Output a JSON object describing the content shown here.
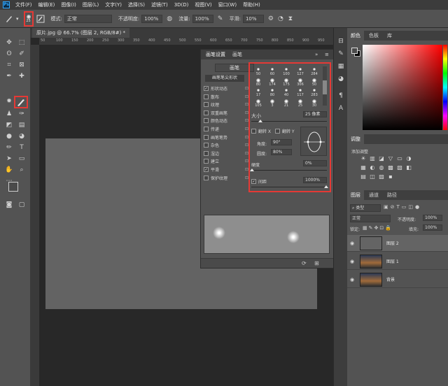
{
  "app": {
    "logo": "Ps"
  },
  "menubar": {
    "items": [
      "文件(F)",
      "编辑(E)",
      "图像(I)",
      "图层(L)",
      "文字(Y)",
      "选择(S)",
      "滤镜(T)",
      "3D(D)",
      "视图(V)",
      "窗口(W)",
      "帮助(H)"
    ]
  },
  "options": {
    "brush_size": "25",
    "mode_label": "模式:",
    "mode_value": "正常",
    "opacity_label": "不透明度:",
    "opacity_value": "100%",
    "flow_label": "流量:",
    "flow_value": "100%",
    "smoothing_label": "平滑:",
    "smoothing_value": "10%"
  },
  "document": {
    "tab_title": "原片.jpg @ 66.7% (图层 2, RGB/8#) *",
    "ruler_numbers": [
      "50",
      "100",
      "150",
      "200",
      "250",
      "300",
      "350",
      "400",
      "450",
      "500",
      "550",
      "600",
      "650",
      "700",
      "750",
      "800",
      "850",
      "900",
      "950"
    ]
  },
  "brush_panel": {
    "tabs": [
      "画笔设置",
      "画笔"
    ],
    "presets_button": "画笔",
    "list_header": "画笔笔尖形状",
    "options": [
      {
        "label": "形状动态",
        "checked": true
      },
      {
        "label": "散布",
        "checked": false
      },
      {
        "label": "纹理",
        "checked": false
      },
      {
        "label": "双重画笔",
        "checked": false
      },
      {
        "label": "颜色动态",
        "checked": false
      },
      {
        "label": "传递",
        "checked": false
      },
      {
        "label": "画笔笔势",
        "checked": false
      },
      {
        "label": "杂色",
        "checked": false
      },
      {
        "label": "湿边",
        "checked": false
      },
      {
        "label": "建立",
        "checked": false
      },
      {
        "label": "平滑",
        "checked": true
      },
      {
        "label": "保护纹理",
        "checked": false
      }
    ],
    "tip_sizes": [
      "50",
      "60",
      "100",
      "127",
      "284",
      "80",
      "174",
      "175",
      "306",
      "50",
      "17",
      "80",
      "40",
      "117",
      "283",
      "105",
      "3",
      "21",
      "25",
      "30"
    ],
    "size_label": "大小",
    "size_value": "25 像素",
    "flip_x_label": "翻转 X",
    "flip_y_label": "翻转 Y",
    "angle_label": "角度:",
    "angle_value": "90°",
    "roundness_label": "圆度:",
    "roundness_value": "80%",
    "hardness_label": "硬度",
    "hardness_value": "0%",
    "spacing_label": "间距",
    "spacing_value": "1000%",
    "spacing_checked": true
  },
  "color_panel": {
    "tabs": [
      "颜色",
      "色板",
      "库"
    ]
  },
  "adjust_panel": {
    "tabs": [
      "调整"
    ],
    "title": "添加调整"
  },
  "layers_panel": {
    "tabs": [
      "图层",
      "通道",
      "路径"
    ],
    "filter_label": "类型",
    "blend_mode": "正常",
    "opacity_label": "不透明度:",
    "opacity_value": "100%",
    "lock_label": "锁定:",
    "fill_label": "填充:",
    "fill_value": "100%",
    "layers": [
      {
        "name": "图层 2",
        "active": true
      },
      {
        "name": "图层 1",
        "active": false
      },
      {
        "name": "背景",
        "active": false
      }
    ]
  },
  "colors": {
    "highlight": "#e53935",
    "panel_bg": "#535353",
    "canvas_bg": "#282828",
    "canvas_image": "#636363"
  }
}
